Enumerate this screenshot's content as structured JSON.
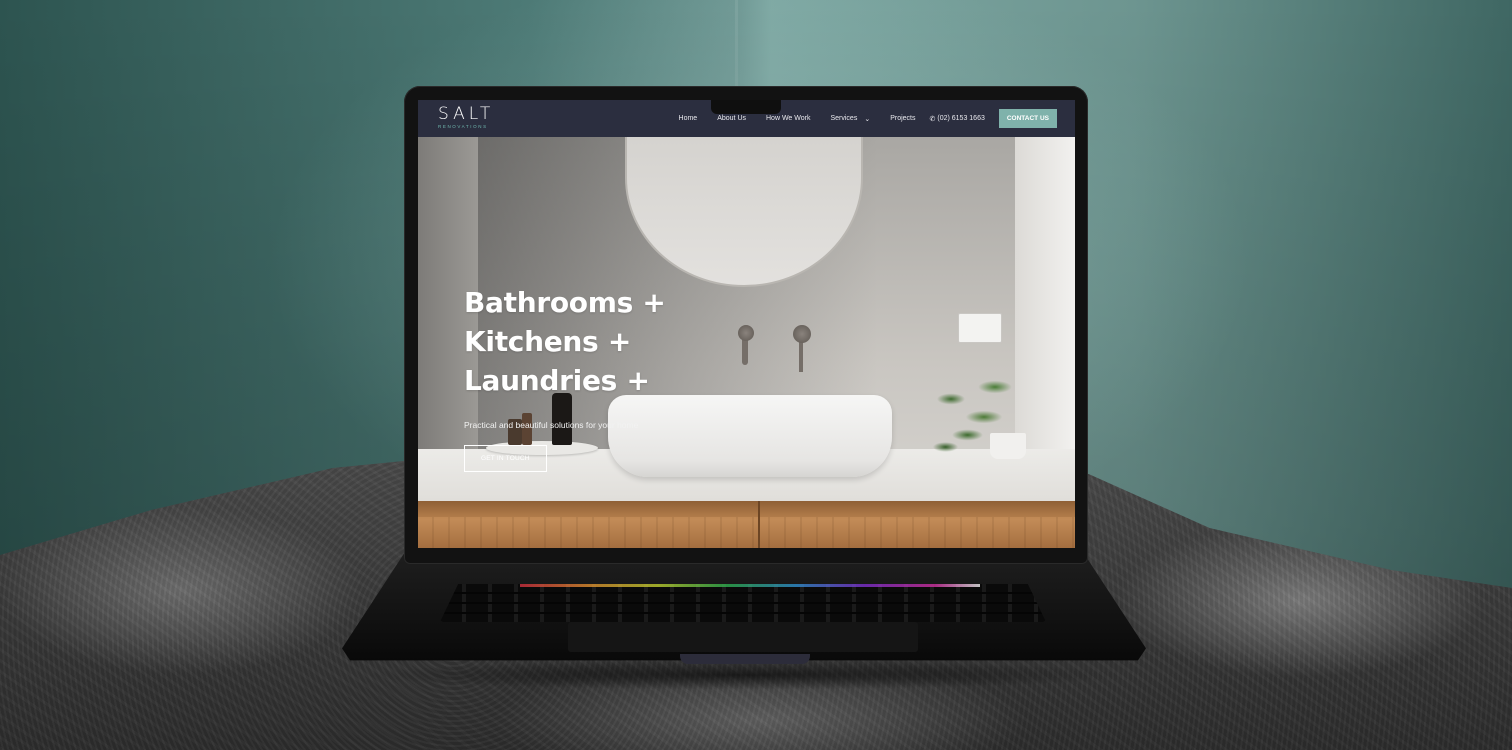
{
  "site": {
    "logo": {
      "main": "SALT",
      "sub": "RENOVATIONS"
    },
    "nav": {
      "items": [
        "Home",
        "About Us",
        "How We Work",
        "Services",
        "Projects"
      ],
      "phone": "(02) 6153 1663",
      "contact_label": "CONTACT US"
    },
    "hero": {
      "title_lines": [
        "Bathrooms +",
        "Kitchens +",
        "Laundries +"
      ],
      "subtitle": "Practical and beautiful solutions for your home",
      "cta_label": "GET IN TOUCH"
    }
  },
  "icons": {
    "services_dropdown": "chevron-down-icon",
    "phone": "phone-icon"
  },
  "colors": {
    "nav_bg": "#2b2e3f",
    "accent": "#7fb2ab",
    "logo_sub": "#6fb7ae",
    "wall": "#4d7a76"
  }
}
